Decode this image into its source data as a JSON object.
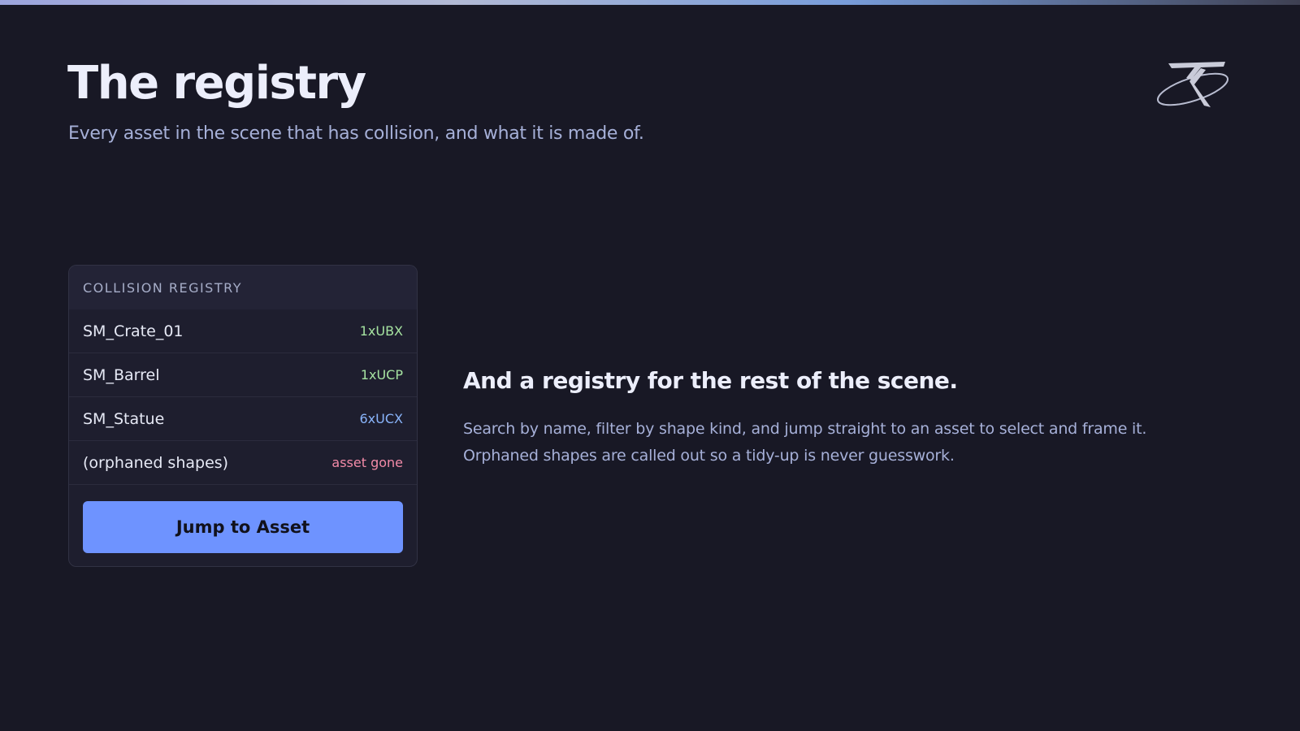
{
  "page": {
    "title": "The registry",
    "subtitle": "Every asset in the scene that has collision, and what it is made of."
  },
  "logo": {
    "icon": "stylized-t-orbit-logo"
  },
  "registry": {
    "header": "COLLISION REGISTRY",
    "rows": [
      {
        "name": "SM_Crate_01",
        "tag": "1xUBX",
        "tag_color": "#a6e3a1"
      },
      {
        "name": "SM_Barrel",
        "tag": "1xUCP",
        "tag_color": "#a6e3a1"
      },
      {
        "name": "SM_Statue",
        "tag": "6xUCX",
        "tag_color": "#89b4fa"
      },
      {
        "name": "(orphaned shapes)",
        "tag": "asset gone",
        "tag_color": "#f38ba8"
      }
    ],
    "button_label": "Jump to Asset"
  },
  "feature": {
    "title": "And a registry for the rest of the scene.",
    "desc_line1": "Search by name, filter by shape kind, and jump straight to an asset to select and frame it.",
    "desc_line2": "Orphaned shapes are called out so a tidy-up is never guesswork."
  },
  "colors": {
    "background": "#181825",
    "accent": "#6e93ff",
    "ok": "#a6e3a1",
    "info": "#89b4fa",
    "error": "#f38ba8"
  }
}
